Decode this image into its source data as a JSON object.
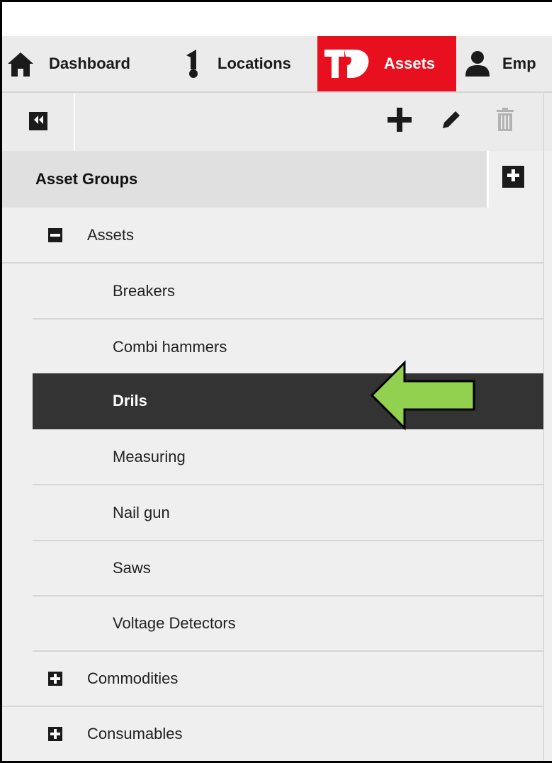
{
  "nav": {
    "items": [
      {
        "label": "Dashboard",
        "icon": "home-icon",
        "active": false
      },
      {
        "label": "Locations",
        "icon": "location-pin-icon",
        "active": false
      },
      {
        "label": "Assets",
        "icon": "assets-logo-icon",
        "active": true
      },
      {
        "label": "Emp",
        "icon": "person-icon",
        "active": false
      }
    ]
  },
  "toolbar": {
    "collapse_icon": "double-chevron-left-icon",
    "add_icon": "plus-icon",
    "edit_icon": "pencil-icon",
    "delete_icon": "trash-icon"
  },
  "sidebar": {
    "title": "Asset Groups",
    "add_group_icon": "plus-square-icon",
    "groups": [
      {
        "label": "Assets",
        "expanded": true,
        "children": [
          {
            "label": "Breakers",
            "selected": false
          },
          {
            "label": "Combi hammers",
            "selected": false
          },
          {
            "label": "Drils",
            "selected": true
          },
          {
            "label": "Measuring",
            "selected": false
          },
          {
            "label": "Nail gun",
            "selected": false
          },
          {
            "label": "Saws",
            "selected": false
          },
          {
            "label": "Voltage Detectors",
            "selected": false
          }
        ]
      },
      {
        "label": "Commodities",
        "expanded": false,
        "children": []
      },
      {
        "label": "Consumables",
        "expanded": false,
        "children": []
      }
    ]
  },
  "colors": {
    "accent": "#e8101f",
    "selected_row": "#333333",
    "arrow": "#92d050"
  }
}
